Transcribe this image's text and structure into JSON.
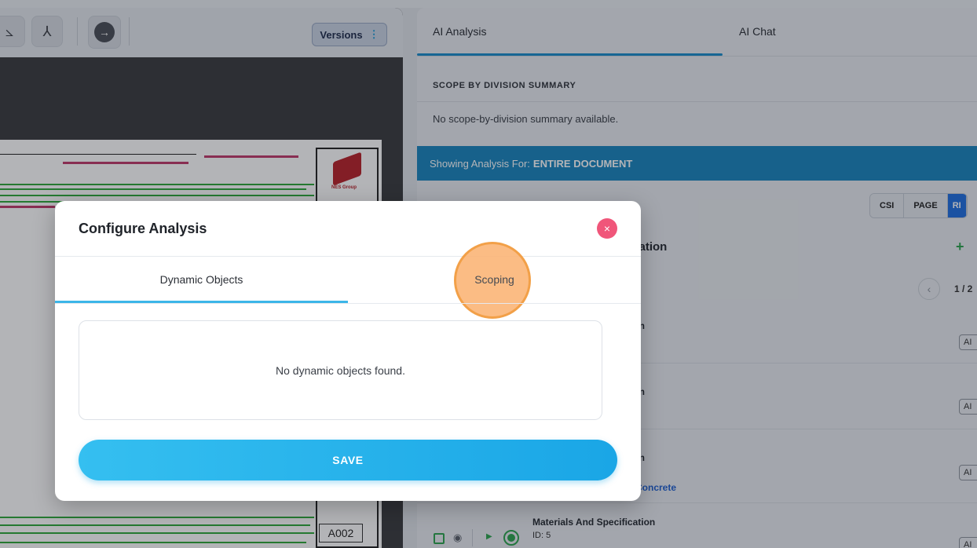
{
  "toolbar": {
    "versions_label": "Versions",
    "versions_menu": "⋮",
    "icons": [
      "measure-icon",
      "merge-icon",
      "arrow-right-icon"
    ]
  },
  "drawing": {
    "sheet_number": "A002",
    "brand_text": "NES Group"
  },
  "right_panel": {
    "tabs": [
      {
        "label": "AI Analysis",
        "active": true
      },
      {
        "label": "AI Chat",
        "active": false
      }
    ],
    "scope_heading": "SCOPE BY DIVISION SUMMARY",
    "scope_empty": "No scope-by-division summary available.",
    "showing_prefix": "Showing Analysis For:",
    "showing_value": "ENTIRE DOCUMENT",
    "view_toggles": [
      "CSI",
      "PAGE",
      "RI"
    ],
    "spec_title": "ication",
    "pager_text": "1 / 2",
    "rows": [
      {
        "title": "tion",
        "badge": "AI"
      },
      {
        "title": "tion",
        "badge": "AI"
      },
      {
        "title": "tion",
        "badge": "AI",
        "link": "e Concrete"
      }
    ],
    "bottom_row": {
      "title": "Materials And Specification",
      "id_text": "ID: 5",
      "badge": "AI"
    }
  },
  "modal": {
    "title": "Configure Analysis",
    "close_symbol": "×",
    "tabs": [
      {
        "label": "Dynamic Objects",
        "active": true
      },
      {
        "label": "Scoping",
        "active": false,
        "highlighted": true
      }
    ],
    "empty_message": "No dynamic objects found.",
    "save_label": "SAVE"
  },
  "colors": {
    "accent": "#1a85bf",
    "save_button": "#27b3ec",
    "close_button": "#f0567a",
    "highlight": "#f2a048"
  }
}
